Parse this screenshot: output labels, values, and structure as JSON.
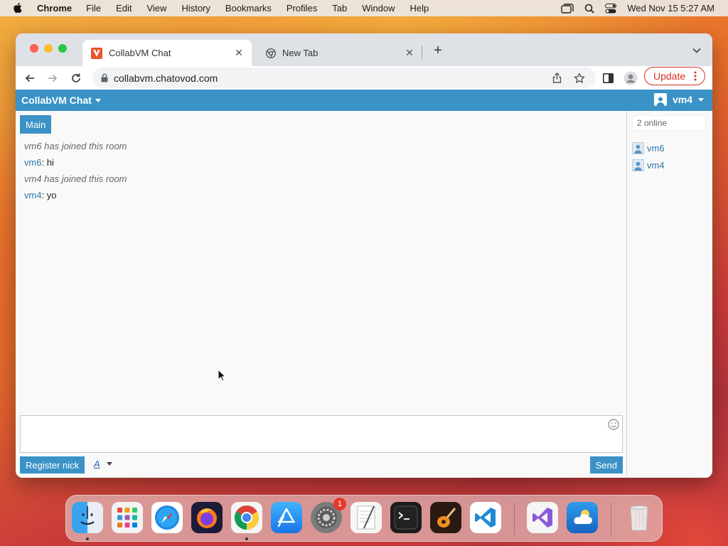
{
  "menubar": {
    "app": "Chrome",
    "items": [
      "File",
      "Edit",
      "View",
      "History",
      "Bookmarks",
      "Profiles",
      "Tab",
      "Window",
      "Help"
    ],
    "datetime": "Wed Nov 15  5:27 AM"
  },
  "browser": {
    "tabs": [
      {
        "title": "CollabVM Chat",
        "favicon": "collabvm-favicon",
        "active": true
      },
      {
        "title": "New Tab",
        "favicon": "chrome-favicon",
        "active": false
      }
    ],
    "url": "collabvm.chatovod.com",
    "update_label": "Update"
  },
  "chat": {
    "brand": "CollabVM Chat",
    "current_user": "vm4",
    "room_tab": "Main",
    "messages": [
      {
        "type": "system",
        "text": "vm6 has joined this room"
      },
      {
        "type": "user",
        "nick": "vm6",
        "sep": ": ",
        "text": "hi"
      },
      {
        "type": "system",
        "text": "vm4 has joined this room"
      },
      {
        "type": "user",
        "nick": "vm4",
        "sep": ": ",
        "text": "yo"
      }
    ],
    "register_label": "Register nick",
    "font_label": "A",
    "send_label": "Send",
    "online_count": "2 online",
    "users": [
      "vm6",
      "vm4"
    ],
    "accent_color": "#3a92c6"
  },
  "dock": {
    "apps": [
      "finder-icon",
      "launchpad-icon",
      "safari-icon",
      "firefox-icon",
      "chrome-icon",
      "app-store-icon",
      "system-settings-icon",
      "textedit-icon",
      "terminal-icon",
      "garageband-icon",
      "vscode-icon",
      "visual-studio-icon",
      "weather-icon",
      "trash-icon"
    ],
    "settings_badge": "1"
  }
}
